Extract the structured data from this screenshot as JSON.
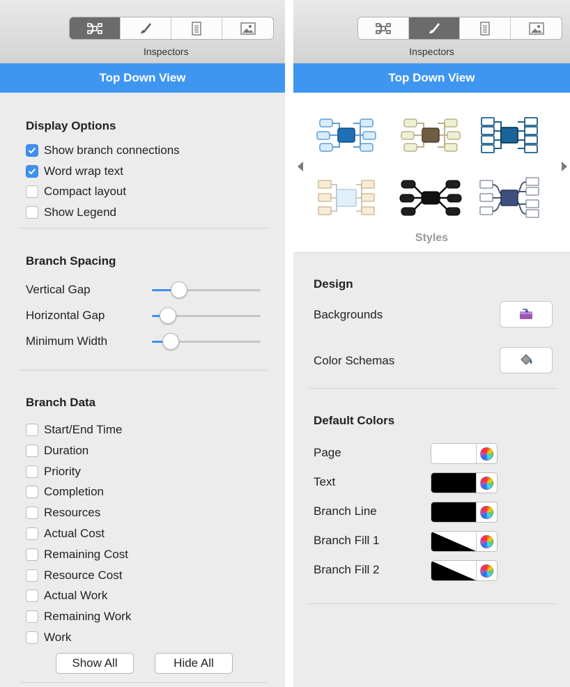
{
  "inspector": {
    "label": "Inspectors",
    "title": "Top Down View"
  },
  "left": {
    "display_options": {
      "title": "Display Options",
      "items": [
        {
          "label": "Show branch connections",
          "checked": true
        },
        {
          "label": "Word wrap text",
          "checked": true
        },
        {
          "label": "Compact layout",
          "checked": false
        },
        {
          "label": "Show Legend",
          "checked": false
        }
      ]
    },
    "branch_spacing": {
      "title": "Branch Spacing",
      "sliders": [
        {
          "label": "Vertical Gap",
          "value": 0.25
        },
        {
          "label": "Horizontal Gap",
          "value": 0.15
        },
        {
          "label": "Minimum Width",
          "value": 0.17
        }
      ]
    },
    "branch_data": {
      "title": "Branch Data",
      "items": [
        {
          "label": "Start/End Time",
          "checked": false
        },
        {
          "label": "Duration",
          "checked": false
        },
        {
          "label": "Priority",
          "checked": false
        },
        {
          "label": "Completion",
          "checked": false
        },
        {
          "label": "Resources",
          "checked": false
        },
        {
          "label": "Actual Cost",
          "checked": false
        },
        {
          "label": "Remaining Cost",
          "checked": false
        },
        {
          "label": "Resource Cost",
          "checked": false
        },
        {
          "label": "Actual Work",
          "checked": false
        },
        {
          "label": "Remaining Work",
          "checked": false
        },
        {
          "label": "Work",
          "checked": false
        }
      ],
      "show_all_label": "Show All",
      "hide_all_label": "Hide All"
    }
  },
  "right": {
    "styles": {
      "label": "Styles"
    },
    "design": {
      "title": "Design",
      "backgrounds_label": "Backgrounds",
      "color_schemas_label": "Color Schemas"
    },
    "default_colors": {
      "title": "Default Colors",
      "items": [
        {
          "label": "Page",
          "color": "#ffffff"
        },
        {
          "label": "Text",
          "color": "#000000"
        },
        {
          "label": "Branch Line",
          "color": "#000000"
        },
        {
          "label": "Branch Fill 1",
          "color": "#000000"
        },
        {
          "label": "Branch Fill 2",
          "color": "#000000"
        }
      ]
    }
  },
  "colors": {
    "accent": "#3f96f1",
    "checkbox": "#3f8ff0"
  }
}
